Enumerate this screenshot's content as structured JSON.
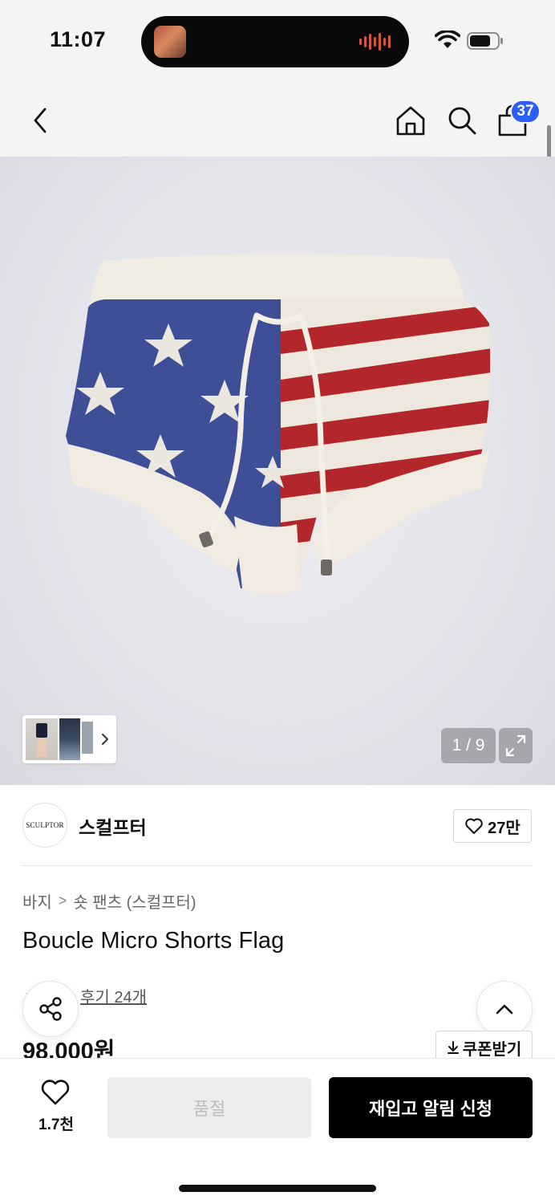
{
  "status_bar": {
    "time": "11:07"
  },
  "header": {
    "cart_count": "37"
  },
  "gallery": {
    "counter": "1 / 9"
  },
  "brand": {
    "logo_text": "SCULPTOR",
    "name": "스컬프터",
    "like_count": "27만"
  },
  "breadcrumb": {
    "category": "바지",
    "separator": ">",
    "subcategory": "숏 팬츠 (스컬프터)"
  },
  "product": {
    "title": "Boucle Micro Shorts Flag",
    "review_link": "후기 24개",
    "price": "98,000원"
  },
  "coupon": {
    "label": "쿠폰받기"
  },
  "bottom_bar": {
    "wish_count": "1.7천",
    "soldout_label": "품절",
    "restock_label": "재입고 알림 신청"
  },
  "colors": {
    "accent_badge": "#2b5ef7",
    "primary_button": "#000000",
    "rating_star": "#f5a623"
  }
}
